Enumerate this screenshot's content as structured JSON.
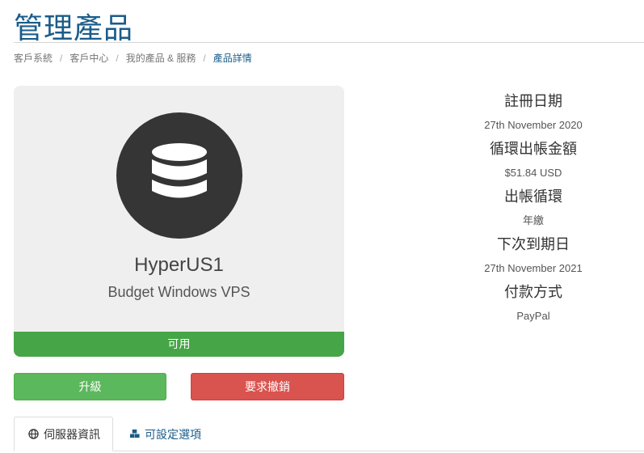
{
  "page": {
    "title": "管理產品"
  },
  "breadcrumb": {
    "items": [
      "客戶系統",
      "客戶中心",
      "我的產品 & 服務"
    ],
    "active": "產品詳情",
    "separator": "/"
  },
  "product": {
    "icon": "database-icon",
    "name": "HyperUS1",
    "group": "Budget Windows VPS",
    "status": "可用",
    "status_color": "#46a546"
  },
  "actions": {
    "upgrade_label": "升級",
    "cancel_label": "要求撤銷"
  },
  "details": {
    "reg_date_label": "註冊日期",
    "reg_date_value": "27th November 2020",
    "recurring_label": "循環出帳金額",
    "recurring_value": "$51.84 USD",
    "cycle_label": "出帳循環",
    "cycle_value": "年繳",
    "next_due_label": "下次到期日",
    "next_due_value": "27th November 2021",
    "payment_label": "付款方式",
    "payment_value": "PayPal"
  },
  "tabs": {
    "server_info": {
      "label": "伺服器資訊",
      "icon": "globe-icon"
    },
    "config_options": {
      "label": "可設定選項",
      "icon": "cubes-icon"
    }
  }
}
